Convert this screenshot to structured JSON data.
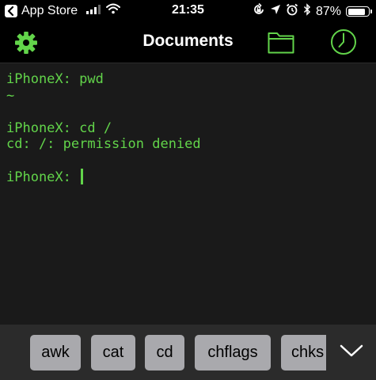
{
  "status_bar": {
    "back_app": "App Store",
    "time": "21:35",
    "battery": "87%",
    "battery_level": 0.87,
    "icons": [
      "back-chevron-icon",
      "signal-icon",
      "wifi-icon",
      "rotation-lock-icon",
      "location-icon",
      "alarm-icon",
      "bluetooth-icon",
      "battery-icon"
    ]
  },
  "nav": {
    "title": "Documents",
    "left_icon": "gear-icon",
    "right_icons": [
      "folder-icon",
      "clock-icon"
    ],
    "accent": "#62d44a"
  },
  "terminal": {
    "lines": [
      "iPhoneX: pwd",
      "~",
      "",
      "iPhoneX: cd /",
      "cd: /: permission denied",
      ""
    ],
    "prompt": "iPhoneX: ",
    "text_color": "#62d44a"
  },
  "commands": [
    "awk",
    "cat",
    "cd",
    "chflags",
    "chks"
  ],
  "dismiss_icon": "chevron-down-icon"
}
